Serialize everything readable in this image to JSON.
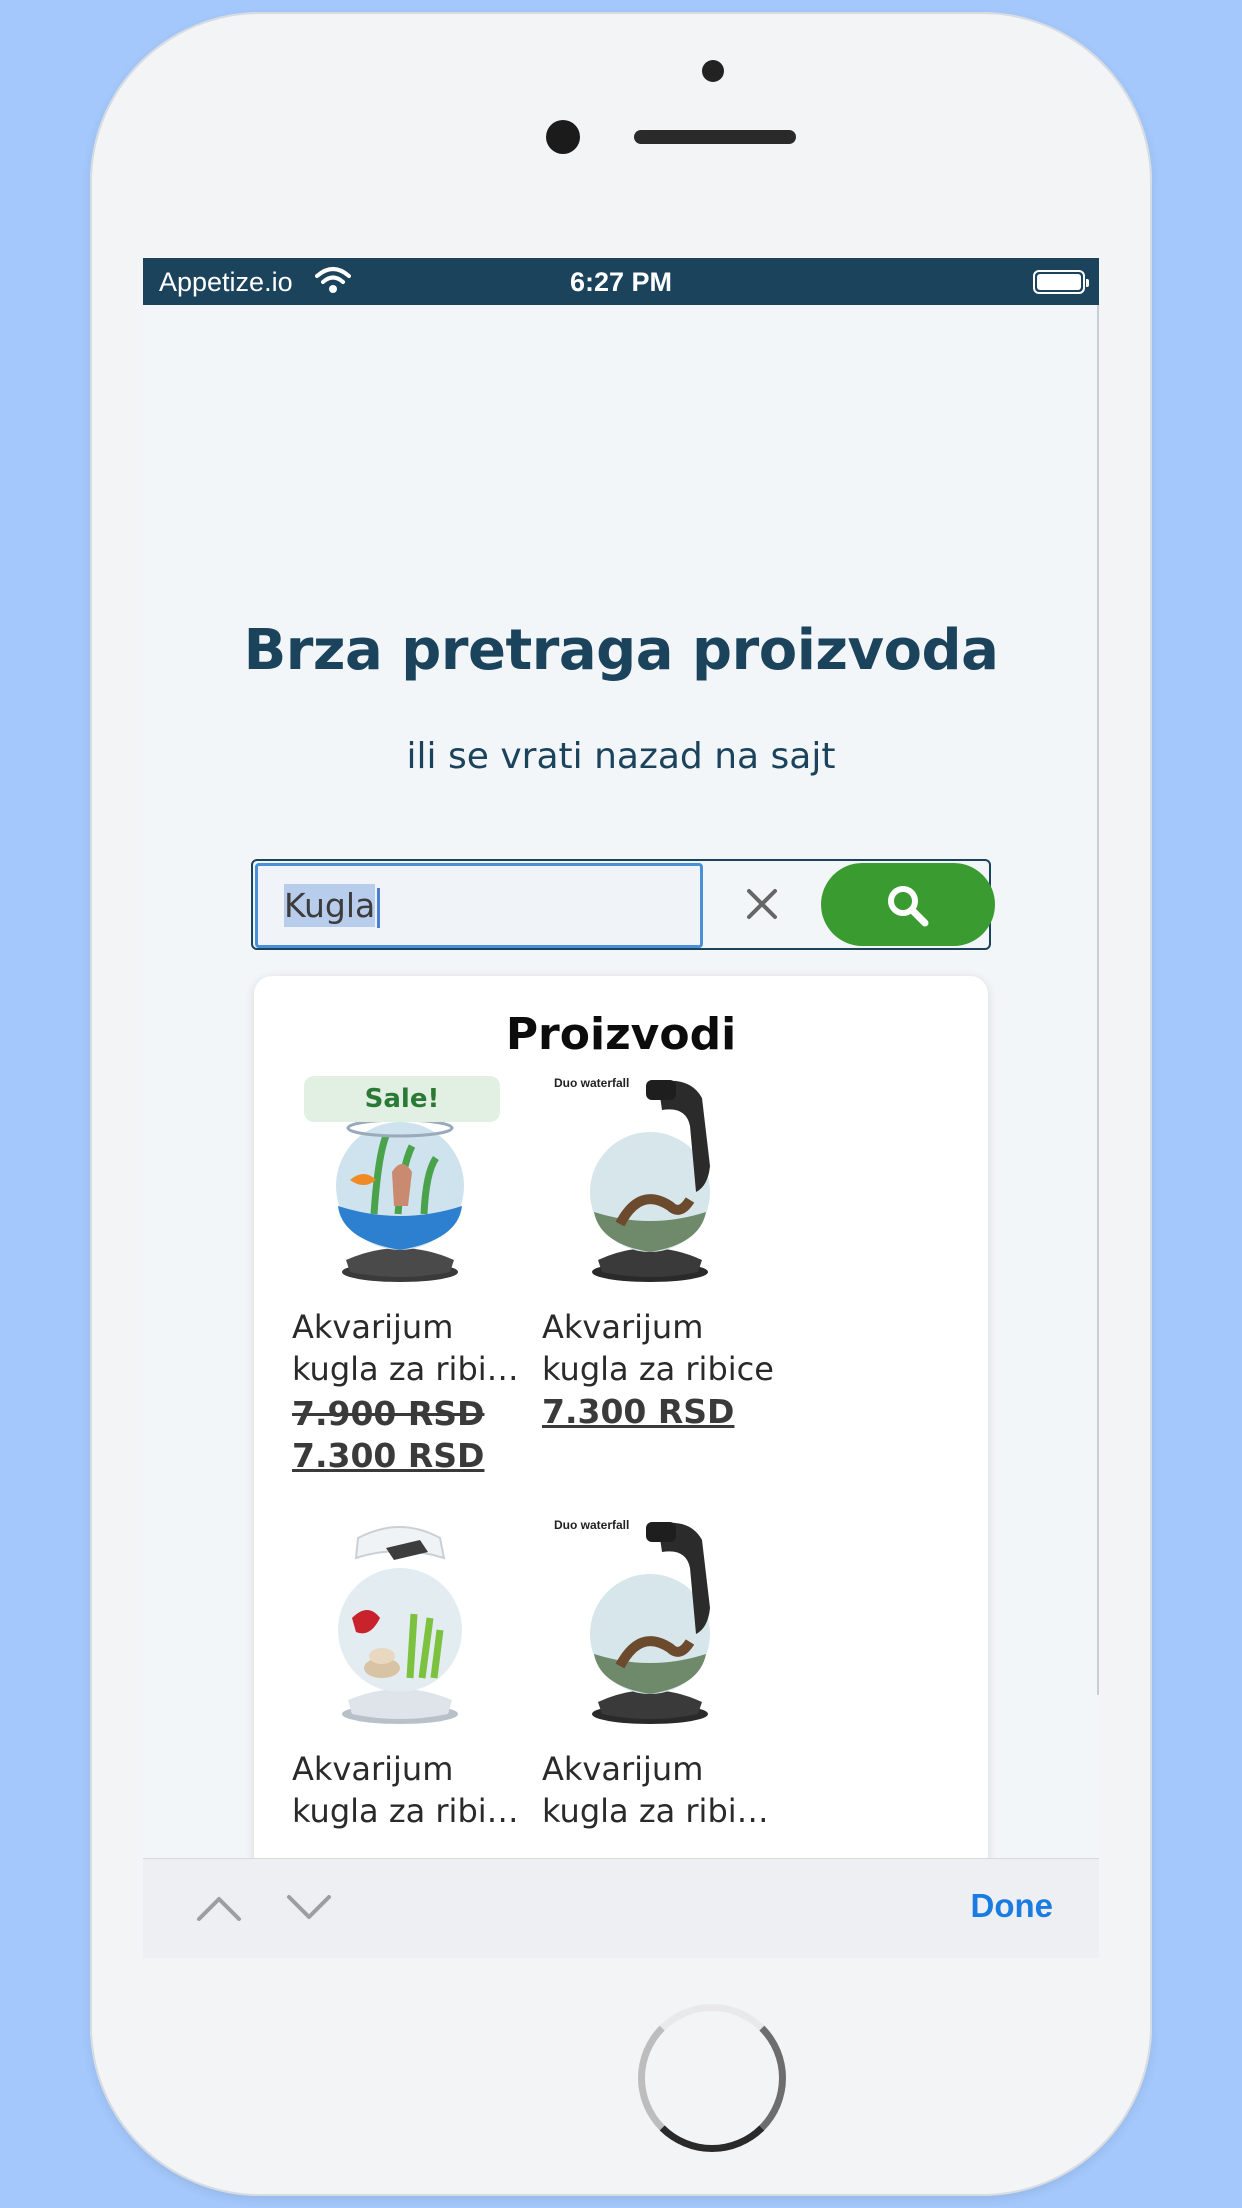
{
  "status_bar": {
    "carrier": "Appetize.io",
    "time": "6:27 PM"
  },
  "page": {
    "title": "Brza pretraga proizvoda",
    "subtitle": "ili se vrati nazad na sajt"
  },
  "search": {
    "value": "Kugla"
  },
  "results": {
    "heading": "Proizvodi",
    "products": [
      {
        "name_line1": "Akvarijum",
        "name_line2": "kugla za ribic...",
        "badge": "Sale!",
        "old_price": "7.900 RSD",
        "price": "7.300 RSD"
      },
      {
        "name_line1": "Akvarijum",
        "name_line2": "kugla za ribice",
        "image_label": "Duo waterfall",
        "price": "7.300 RSD"
      },
      {
        "name_line1": "Akvarijum",
        "name_line2": "kugla za ribic..."
      },
      {
        "name_line1": "Akvarijum",
        "name_line2": "kugla za ribic...",
        "image_label": "Duo waterfall"
      }
    ]
  },
  "keyboard_toolbar": {
    "done_label": "Done"
  },
  "colors": {
    "brand_dark": "#1b435c",
    "search_green": "#3a9b31",
    "link_blue": "#1a7ce0",
    "sale_green": "#2a7a35"
  },
  "icons": [
    "wifi-icon",
    "battery-icon",
    "clear-icon",
    "search-icon",
    "chevron-up-icon",
    "chevron-down-icon"
  ]
}
